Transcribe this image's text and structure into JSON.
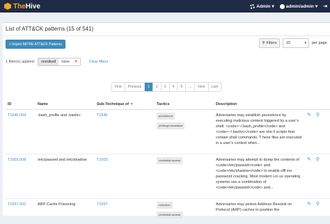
{
  "app": {
    "brand_the": "The",
    "brand_hive": "Hive"
  },
  "topbar": {
    "admin_label": "Admin",
    "user_label": "admin/admin",
    "signout": "⇥"
  },
  "panel": {
    "title": "List of ATT&CK patterns (15 of 541)"
  },
  "toolbar": {
    "import_label": "+ Import MITRE ATT&CK Patterns",
    "filters_label": "Filters",
    "page_size": "15",
    "per_page_label": "per page"
  },
  "filters": {
    "applied_label": "1 filter(s) applied:",
    "chip_key": "revoked",
    "chip_value": "false",
    "clear_label": "Clear filters"
  },
  "pager": {
    "first": "First",
    "previous": "Previous",
    "pages": [
      "1",
      "2",
      "3",
      "4",
      "5",
      "..."
    ],
    "next": "Next",
    "last": "Last"
  },
  "table": {
    "headers": {
      "id": "ID",
      "name": "Name",
      "sub": "Sub-Technique of",
      "tactics": "Tactics",
      "desc": "Description"
    },
    "rows": [
      {
        "id": "T1546.004",
        "name": ".bash_profile and .bashrc",
        "sub": "T1546",
        "tactics": [
          "persistence",
          "privilege-escalation"
        ],
        "desc": "Adversaries may establish persistence by executing malicious content triggered by a user’s shell. <code>~/.bash_profile</code> and <code>~/.bashrc</code> are she ll scripts that contain shell commands. T hese files are executed in a user’s context when..."
      },
      {
        "id": "T1003.008",
        "name": "/etc/passwd and /etc/shadow",
        "sub": "T1003",
        "tactics": [
          "credential-access"
        ],
        "desc": "Adversaries may attempt to dump the contents of <code>/etc/passwd</code> and <code>/etc/shadow</code> to enable offl ine password cracking. Most modern Lin ux operating systems use a combination of <code>/etc/passwd</code> and..."
      },
      {
        "id": "T1557.002",
        "name": "ARP Cache Poisoning",
        "sub": "T1557",
        "tactics": [
          "collection",
          "credential-access"
        ],
        "desc": "Adversaries may poison Address Resoluti on Protocol (ARP) caches to position the"
      }
    ]
  }
}
